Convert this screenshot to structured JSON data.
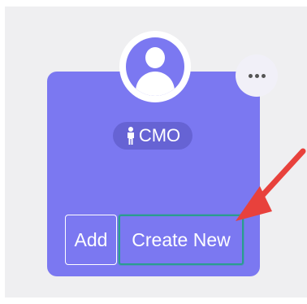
{
  "card": {
    "role_label": "CMO",
    "add_label": "Add",
    "create_label": "Create New"
  },
  "icons": {
    "avatar": "user-avatar-icon",
    "role": "person-icon",
    "more": "more-horizontal-icon",
    "annotation": "red-arrow"
  },
  "colors": {
    "card_bg": "#7b78f1",
    "badge_bg": "#6663d4",
    "focus_outline": "#2a9d8f",
    "arrow": "#e8413c"
  }
}
